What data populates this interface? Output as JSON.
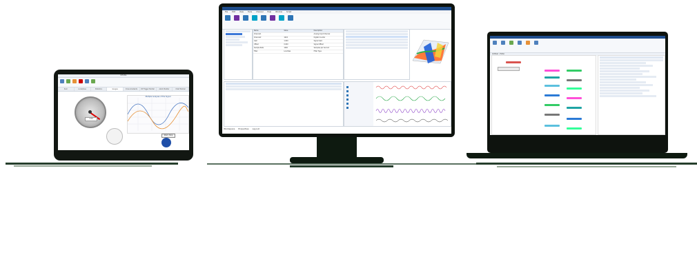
{
  "tablet": {
    "window_title": "IRTANA",
    "tabs": [
      "Item",
      "Local/Area",
      "Statistics",
      "Gauges",
      "Cross Gradients",
      "DP Trigger Builder",
      "Alarm Builder",
      "Chart Builder"
    ],
    "active_tab": "Gauges",
    "chart_title": "Multiple Analyses of the Signal",
    "gauge_reading": "2.59",
    "readout_button": "Start / Stop"
  },
  "monitor": {
    "menu": [
      "File",
      "Edit",
      "View",
      "Tools",
      "Channel",
      "Help",
      "Window",
      "Script"
    ],
    "status_tabs": [
      "Workspace",
      "Properties",
      "Layout"
    ],
    "table": {
      "headers": [
        "Name",
        "Value",
        "Description"
      ],
      "rows": [
        [
          "Channel1",
          "",
          "Analog Input Channel"
        ],
        [
          "Channel2",
          "1024",
          "Digital Counter"
        ],
        [
          "Gain",
          "1.000",
          "Signal Gain"
        ],
        [
          "Offset",
          "0.000",
          "Signal Offset"
        ],
        [
          "Sample Rate",
          "1000",
          "Samples per Second"
        ],
        [
          "Filter",
          "Low Pass",
          "Filter Type"
        ]
      ]
    }
  },
  "laptop": {
    "window_title": "Untitled - Editor",
    "colors": [
      "#d9534f",
      "#ff4fd8",
      "#33cc66",
      "#1fa3a3",
      "#777777",
      "#5bc0de",
      "#33ff99",
      "#2b7ad6"
    ]
  }
}
